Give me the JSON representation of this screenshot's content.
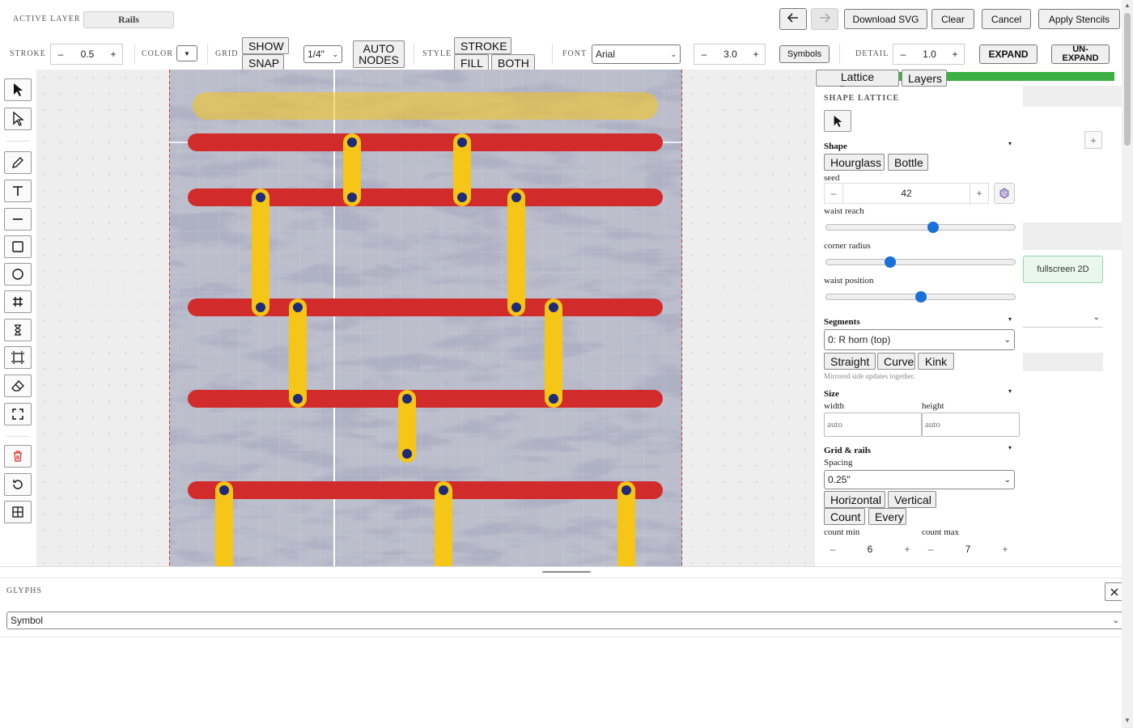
{
  "header": {
    "active_layer_label": "ACTIVE LAYER",
    "active_layer_value": "Rails",
    "download_svg": "Download SVG",
    "clear": "Clear",
    "cancel": "Cancel",
    "apply_stencils": "Apply Stencils"
  },
  "toolbar": {
    "stroke_label": "STROKE",
    "stroke_value": "0.5",
    "color_label": "COLOR",
    "grid_label": "GRID",
    "show": "SHOW",
    "snap": "SNAP",
    "grid_size": "1/4\"",
    "auto_nodes_1": "AUTO",
    "auto_nodes_2": "NODES",
    "style_label": "STYLE",
    "style_stroke": "STROKE",
    "style_fill": "FILL",
    "style_both": "BOTH",
    "font_label": "FONT",
    "font_value": "Arial",
    "font_size": "3.0",
    "symbols": "Symbols",
    "detail_label": "DETAIL",
    "detail_value": "1.0",
    "expand": "EXPAND",
    "unexpand_1": "UN-",
    "unexpand_2": "EXPAND",
    "minus": "–",
    "plus": "+"
  },
  "panel": {
    "tab_lattice": "Lattice Pattern",
    "tab_layers": "Layers",
    "title": "SHAPE LATTICE",
    "shape_title": "Shape",
    "hourglass": "Hourglass",
    "bottle": "Bottle",
    "seed_label": "seed",
    "seed_value": "42",
    "waist_reach_label": "waist reach",
    "waist_reach": 0.57,
    "corner_radius_label": "corner radius",
    "corner_radius": 0.33,
    "waist_position_label": "waist position",
    "waist_position": 0.5,
    "segments_title": "Segments",
    "segment_selected": "0: R horn (top)",
    "straight": "Straight",
    "curve": "Curve",
    "kink": "Kink",
    "mirror_note": "Mirrored side updates together.",
    "size_title": "Size",
    "width_label": "width",
    "height_label": "height",
    "width_placeholder": "auto",
    "height_placeholder": "auto",
    "grid_rails_title": "Grid & rails",
    "spacing_label": "Spacing",
    "spacing_value": "0.25\"",
    "horizontal": "Horizontal",
    "vertical": "Vertical",
    "count": "Count",
    "every": "Every",
    "count_min_label": "count min",
    "count_min": "6",
    "count_max_label": "count max",
    "count_max": "7",
    "fullscreen": "fullscreen 2D",
    "behind_plus": "+"
  },
  "glyphs": {
    "title": "GLYPHS",
    "select_value": "Symbol"
  },
  "colors": {
    "rail": "#d22b2b",
    "link": "#f5c518",
    "node": "#1f2a78",
    "accent_green": "#3cb043"
  }
}
